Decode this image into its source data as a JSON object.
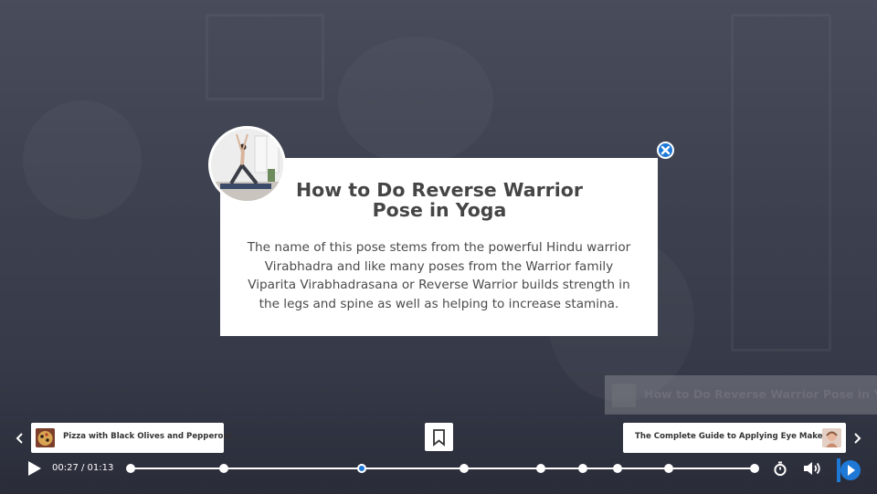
{
  "background": {
    "watermark_title": "How to Do Reverse Warrior Pose in Yoga"
  },
  "popup": {
    "title": "How to Do Reverse Warrior Pose in Yoga",
    "description": "The name of this pose stems from the powerful Hindu warrior Virabhadra and like many poses from the Warrior family Viparita Virabhadrasana or Reverse Warrior builds strength in the legs and spine as well as helping to increase stamina.",
    "avatar_icon": "yoga-pose-photo",
    "close_icon": "close-icon"
  },
  "navigation": {
    "previous": {
      "label": "Pizza with Black Olives and Pepperoni",
      "icon": "chevron-left-icon"
    },
    "next": {
      "label": "The Complete Guide to Applying Eye Makeup.",
      "icon": "chevron-right-icon"
    },
    "bookmark_icon": "bookmark-icon"
  },
  "player": {
    "current_time": "00:27",
    "duration": "01:13",
    "time_display": "00:27 / 01:13",
    "progress_fraction": 0.37,
    "chapter_markers": [
      0.0,
      0.15,
      0.37,
      0.535,
      0.658,
      0.725,
      0.78,
      0.862,
      1.0
    ],
    "icons": [
      "play-icon",
      "timer-icon",
      "volume-icon",
      "brand-logo-icon"
    ]
  },
  "colors": {
    "accent": "#1e78d6",
    "popup_bg": "#ffffff",
    "text_dark": "#454545",
    "text_body": "#4a4a4a"
  }
}
